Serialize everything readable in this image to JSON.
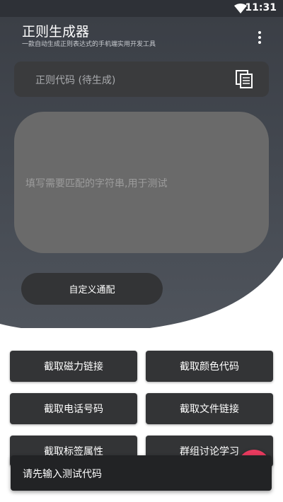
{
  "status_bar": {
    "time": "11:31",
    "wifi_icon": "wifi-icon"
  },
  "header": {
    "title": "正则生成器",
    "subtitle": "一款自动生成正则表达式的手机端实用开发工具",
    "menu_icon": "more-vert-icon"
  },
  "regex_field": {
    "placeholder": "正则代码 (待生成)",
    "copy_icon": "copy-icon"
  },
  "test_input": {
    "placeholder": "填写需要匹配的字符串,用于测试"
  },
  "custom_match_button": "自定义通配",
  "extract_buttons": [
    {
      "label": "截取磁力链接"
    },
    {
      "label": "截取颜色代码"
    },
    {
      "label": "截取电话号码"
    },
    {
      "label": "截取文件链接"
    },
    {
      "label": "截取标签属性"
    },
    {
      "label": "群组讨论学习"
    }
  ],
  "snackbar": {
    "message": "请先输入测试代码"
  },
  "colors": {
    "header_bg": "#3b3f46",
    "field_bg": "#3a3b3d",
    "test_box_bg": "#6a6a6a",
    "button_bg": "#333436",
    "fab": "#e83a5f",
    "snackbar_bg": "#222325"
  }
}
